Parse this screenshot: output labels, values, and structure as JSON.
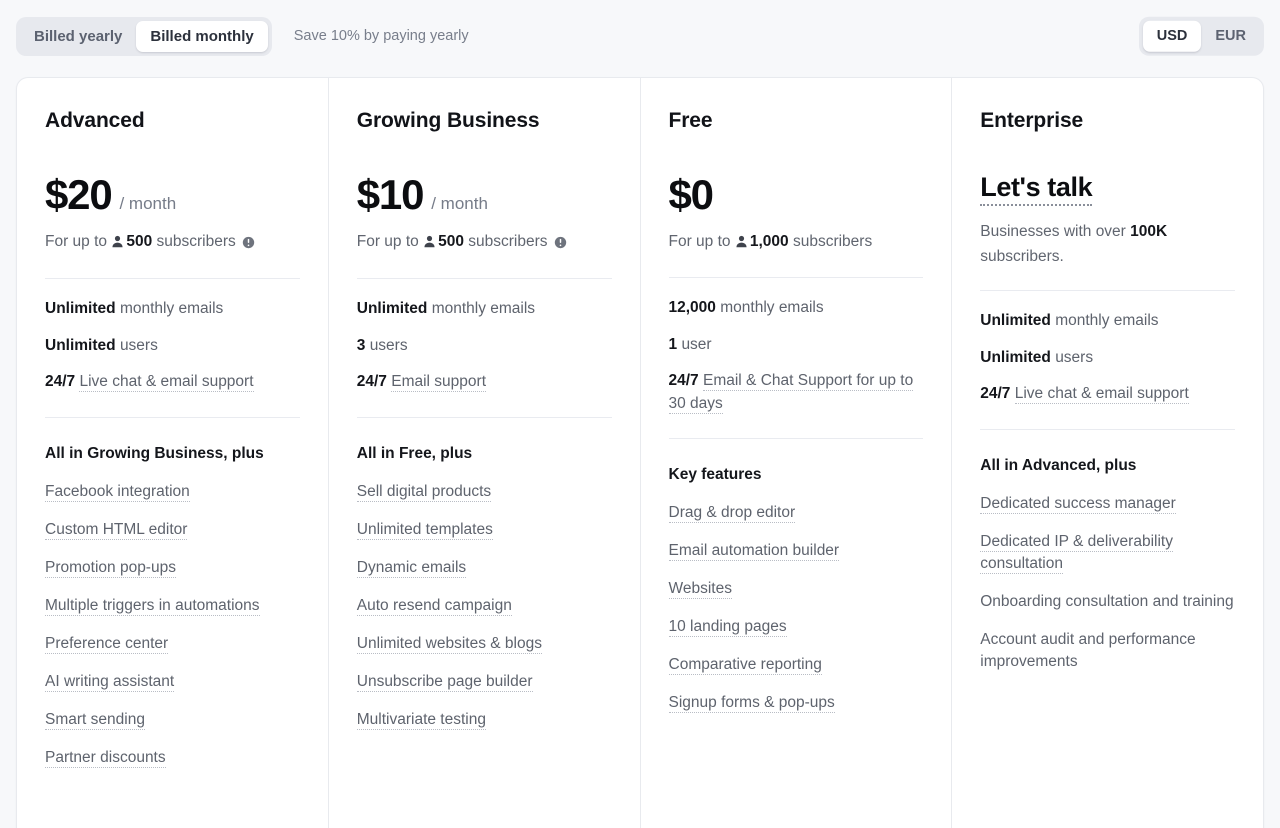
{
  "billing_toggle": {
    "options": [
      {
        "label": "Billed yearly",
        "active": false
      },
      {
        "label": "Billed monthly",
        "active": true
      }
    ],
    "note": "Save 10% by paying yearly"
  },
  "currency_toggle": {
    "options": [
      {
        "label": "USD",
        "active": true
      },
      {
        "label": "EUR",
        "active": false
      }
    ]
  },
  "icons": {
    "user": "user-icon",
    "info": "info-icon"
  },
  "plans": [
    {
      "name": "Advanced",
      "price": "$20",
      "period": "/ month",
      "price_dotted": false,
      "subs_prefix": "For up to",
      "subs_count": "500",
      "subs_suffix": "subscribers",
      "has_user_icon": true,
      "has_info_icon": true,
      "core": [
        {
          "strong": "Unlimited",
          "text": "monthly emails",
          "dotted": false
        },
        {
          "strong": "Unlimited",
          "text": "users",
          "dotted": false
        },
        {
          "strong": "24/7",
          "text": "Live chat & email support",
          "dotted": true
        }
      ],
      "group_title": "All in Growing Business, plus",
      "features": [
        {
          "label": "Facebook integration",
          "dotted": true
        },
        {
          "label": "Custom HTML editor",
          "dotted": true
        },
        {
          "label": "Promotion pop-ups",
          "dotted": true
        },
        {
          "label": "Multiple triggers in automations",
          "dotted": true
        },
        {
          "label": "Preference center",
          "dotted": true
        },
        {
          "label": "AI writing assistant",
          "dotted": true
        },
        {
          "label": "Smart sending",
          "dotted": true
        },
        {
          "label": "Partner discounts",
          "dotted": true
        }
      ]
    },
    {
      "name": "Growing Business",
      "price": "$10",
      "period": "/ month",
      "price_dotted": false,
      "subs_prefix": "For up to",
      "subs_count": "500",
      "subs_suffix": "subscribers",
      "has_user_icon": true,
      "has_info_icon": true,
      "core": [
        {
          "strong": "Unlimited",
          "text": "monthly emails",
          "dotted": false
        },
        {
          "strong": "3",
          "text": "users",
          "dotted": false
        },
        {
          "strong": "24/7",
          "text": "Email support",
          "dotted": true
        }
      ],
      "group_title": "All in Free, plus",
      "features": [
        {
          "label": "Sell digital products",
          "dotted": true
        },
        {
          "label": "Unlimited templates",
          "dotted": true
        },
        {
          "label": "Dynamic emails",
          "dotted": true
        },
        {
          "label": "Auto resend campaign",
          "dotted": true
        },
        {
          "label": "Unlimited websites & blogs",
          "dotted": true
        },
        {
          "label": "Unsubscribe page builder",
          "dotted": true
        },
        {
          "label": "Multivariate testing",
          "dotted": true
        }
      ]
    },
    {
      "name": "Free",
      "price": "$0",
      "period": "",
      "price_dotted": false,
      "subs_prefix": "For up to",
      "subs_count": "1,000",
      "subs_suffix": "subscribers",
      "has_user_icon": true,
      "has_info_icon": false,
      "core": [
        {
          "strong": "12,000",
          "text": "monthly emails",
          "dotted": false
        },
        {
          "strong": "1",
          "text": "user",
          "dotted": false
        },
        {
          "strong": "24/7",
          "text": "Email & Chat Support for up to 30 days",
          "dotted": true
        }
      ],
      "group_title": "Key features",
      "features": [
        {
          "label": "Drag & drop editor",
          "dotted": true
        },
        {
          "label": "Email automation builder",
          "dotted": true
        },
        {
          "label": "Websites",
          "dotted": true
        },
        {
          "label": "10 landing pages",
          "dotted": true
        },
        {
          "label": "Comparative reporting",
          "dotted": true
        },
        {
          "label": "Signup forms & pop-ups",
          "dotted": true
        }
      ]
    },
    {
      "name": "Enterprise",
      "price": "Let's talk",
      "period": "",
      "price_dotted": true,
      "subs_prefix": "Businesses with over",
      "subs_count": "100K",
      "subs_suffix": "subscribers.",
      "has_user_icon": false,
      "has_info_icon": false,
      "core": [
        {
          "strong": "Unlimited",
          "text": "monthly emails",
          "dotted": false
        },
        {
          "strong": "Unlimited",
          "text": "users",
          "dotted": false
        },
        {
          "strong": "24/7",
          "text": "Live chat & email support",
          "dotted": true
        }
      ],
      "group_title": "All in Advanced, plus",
      "features": [
        {
          "label": "Dedicated success manager",
          "dotted": true
        },
        {
          "label": "Dedicated IP & deliverability consultation",
          "dotted": true
        },
        {
          "label": "Onboarding consultation and training",
          "dotted": false
        },
        {
          "label": "Account audit and performance improvements",
          "dotted": false
        }
      ]
    }
  ],
  "colors": {
    "page_bg": "#f7f8fa",
    "card_bg": "#ffffff",
    "border": "#e8eaee",
    "toggle_track": "#e7e9ee",
    "text_primary": "#14161b",
    "text_muted": "#5e636d",
    "dotted_underline": "#b9bdc5"
  }
}
